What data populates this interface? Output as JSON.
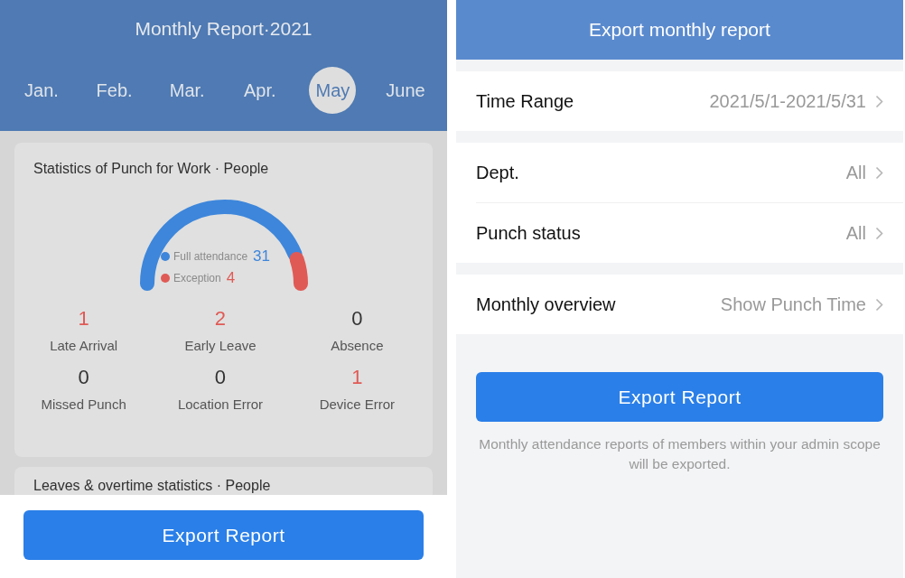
{
  "report_screen": {
    "title": "Monthly Report·2021",
    "months": [
      {
        "label": "Jan.",
        "selected": false
      },
      {
        "label": "Feb.",
        "selected": false
      },
      {
        "label": "Mar.",
        "selected": false
      },
      {
        "label": "Apr.",
        "selected": false
      },
      {
        "label": "May",
        "selected": true
      },
      {
        "label": "June",
        "selected": false
      }
    ],
    "punch_card": {
      "title": "Statistics of Punch for Work · People",
      "legend": [
        {
          "label": "Full attendance",
          "count": "31",
          "color": "#3d86db"
        },
        {
          "label": "Exception",
          "count": "4",
          "color": "#e05a55"
        }
      ],
      "stats": [
        {
          "value": "1",
          "label": "Late Arrival",
          "highlight": true
        },
        {
          "value": "2",
          "label": "Early Leave",
          "highlight": true
        },
        {
          "value": "0",
          "label": "Absence",
          "highlight": false
        },
        {
          "value": "0",
          "label": "Missed Punch",
          "highlight": false
        },
        {
          "value": "0",
          "label": "Location Error",
          "highlight": false
        },
        {
          "value": "1",
          "label": "Device Error",
          "highlight": true
        }
      ]
    },
    "leaves_card": {
      "title": "Leaves & overtime statistics · People"
    },
    "button": "Export Report"
  },
  "export_screen": {
    "title": "Export monthly report",
    "groups": [
      [
        {
          "label": "Time Range",
          "value": "2021/5/1-2021/5/31"
        }
      ],
      [
        {
          "label": "Dept.",
          "value": "All"
        },
        {
          "label": "Punch status",
          "value": "All"
        }
      ],
      [
        {
          "label": "Monthly overview",
          "value": "Show Punch Time"
        }
      ]
    ],
    "button": "Export Report",
    "note": "Monthly attendance reports of members within your admin scope will be exported."
  }
}
